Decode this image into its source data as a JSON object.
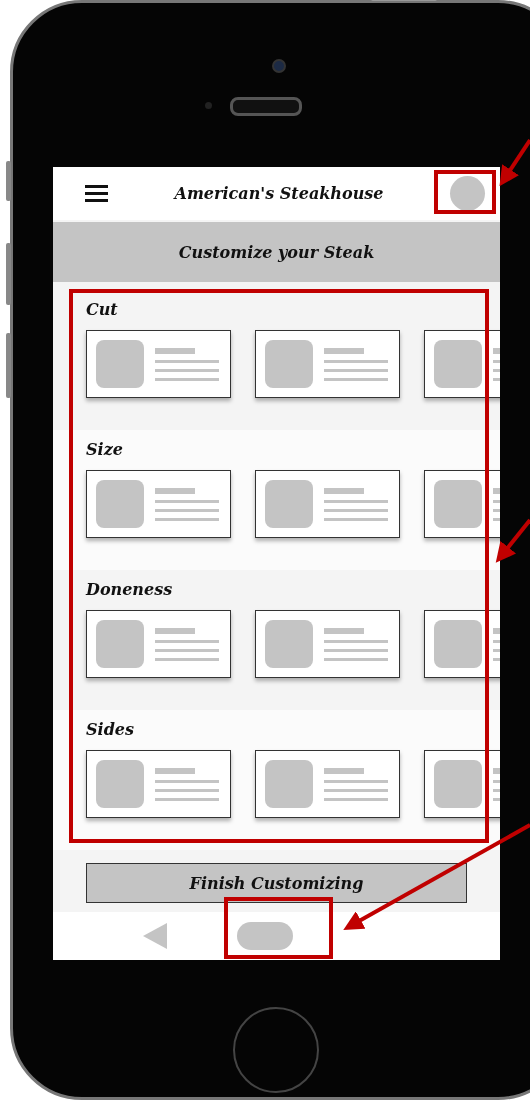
{
  "header": {
    "title": "American's Steakhouse"
  },
  "banner": {
    "title": "Customize your Steak"
  },
  "sections": [
    {
      "label": "Cut"
    },
    {
      "label": "Size"
    },
    {
      "label": "Doneness"
    },
    {
      "label": "Sides"
    }
  ],
  "finish_button": {
    "label": "Finish Customizing"
  }
}
